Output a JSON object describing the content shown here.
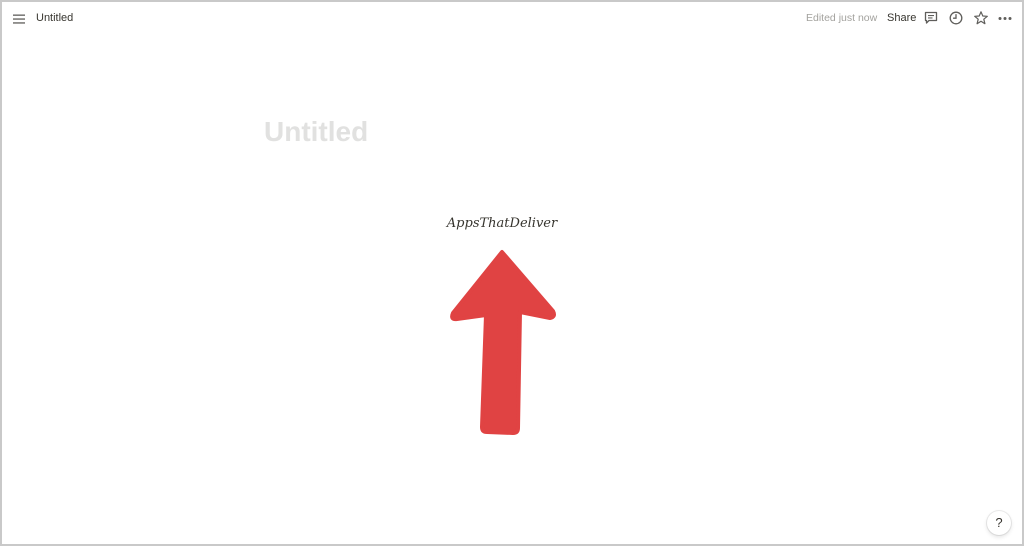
{
  "topbar": {
    "doc_title": "Untitled",
    "edited_status": "Edited just now",
    "share_label": "Share",
    "icons": [
      "menu-icon",
      "comment-icon",
      "history-icon",
      "star-icon",
      "more-icon"
    ]
  },
  "page": {
    "title": "Untitled",
    "brand_text": "AppsThatDeliver",
    "arrow_color": "#e04343"
  },
  "help": {
    "label": "?"
  },
  "colors": {
    "text": "#37352f",
    "muted": "#a3a29e",
    "placeholder": "#e1e1e0",
    "border": "#c9c9c9"
  }
}
